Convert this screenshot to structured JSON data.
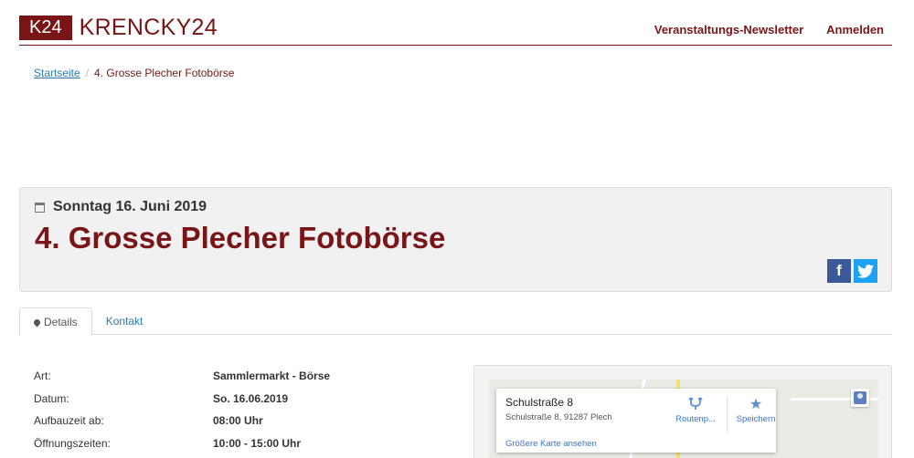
{
  "header": {
    "logo_badge": "K24",
    "logo_text": "KRENCKY24",
    "nav": [
      {
        "label": "Veranstaltungs-Newsletter"
      },
      {
        "label": "Anmelden"
      }
    ]
  },
  "breadcrumb": {
    "home": "Startseite",
    "separator": "/",
    "current": "4. Grosse Plecher Fotobörse"
  },
  "event": {
    "date": "Sonntag 16. Juni 2019",
    "title": "4. Grosse Plecher Fotobörse",
    "social": {
      "facebook": "f",
      "twitter": "t"
    }
  },
  "tabs": [
    {
      "label": "Details",
      "active": true
    },
    {
      "label": "Kontakt",
      "active": false
    }
  ],
  "details": [
    {
      "label": "Art:",
      "value": "Sammlermarkt - Börse"
    },
    {
      "label": "Datum:",
      "value": "So. 16.06.2019"
    },
    {
      "label": "Aufbauzeit ab:",
      "value": "08:00 Uhr"
    },
    {
      "label": "Öffnungszeiten:",
      "value": "10:00 - 15:00 Uhr"
    }
  ],
  "map": {
    "street": "Schulstraße 8",
    "address": "Schulstraße 8, 91287 Plech",
    "route_label": "Routenp...",
    "save_label": "Speichern",
    "bigger_map": "Größere Karte ansehen"
  },
  "colors": {
    "brand": "#7a1517",
    "link": "#2a7ab0",
    "facebook": "#3b5998",
    "twitter": "#1da1f2"
  }
}
